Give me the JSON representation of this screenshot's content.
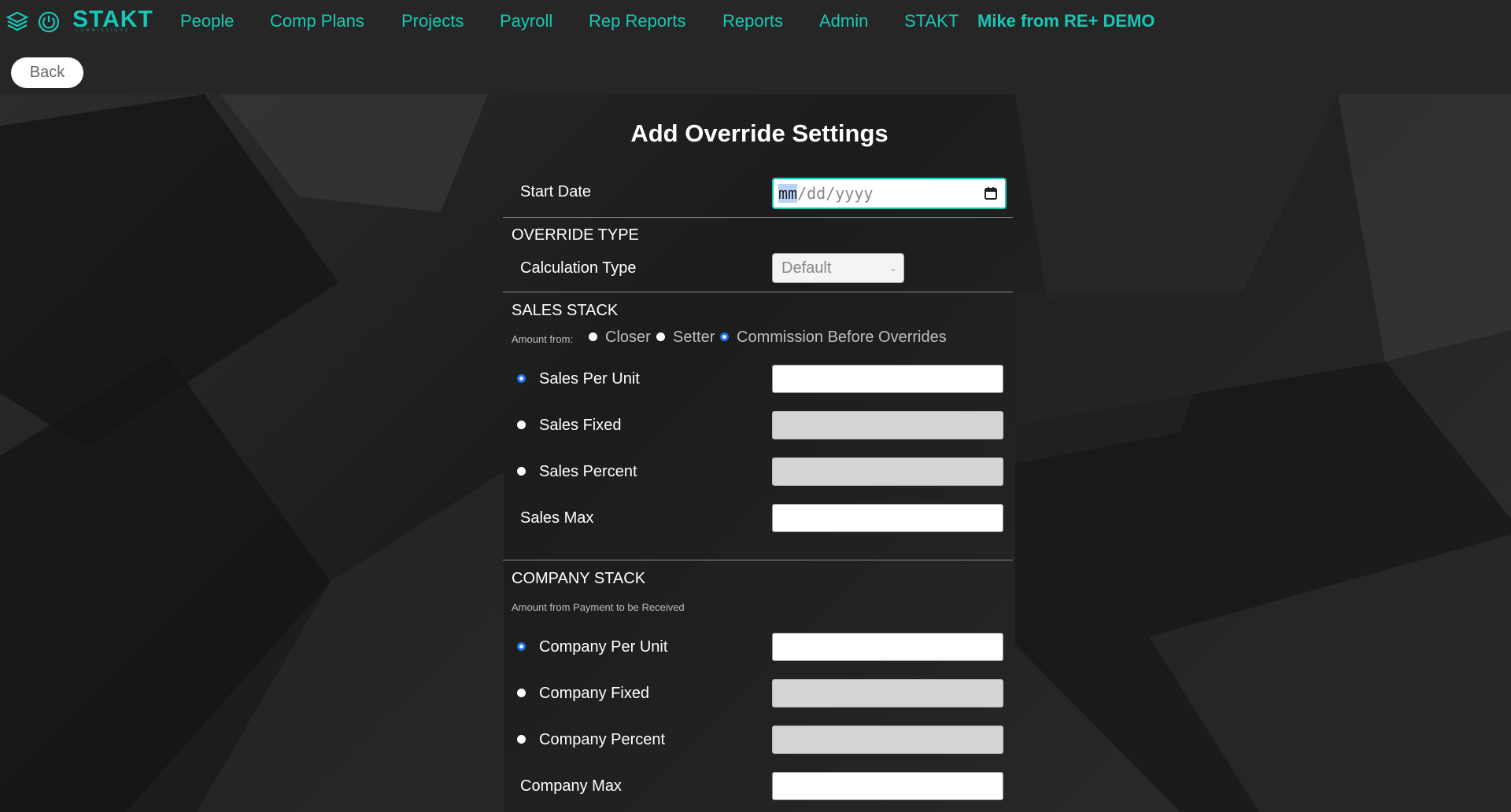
{
  "nav": {
    "logo_text": "STAKT",
    "logo_sub": "COMMISSIONS",
    "links": [
      "People",
      "Comp Plans",
      "Projects",
      "Payroll",
      "Rep Reports",
      "Reports",
      "Admin",
      "STAKT"
    ],
    "user": "Mike from  RE+ DEMO"
  },
  "back_label": "Back",
  "form": {
    "title": "Add Override Settings",
    "start_date_label": "Start Date",
    "start_date_placeholder_mm": "mm",
    "start_date_placeholder_rest": "/dd/yyyy",
    "override_type_title": "OVERRIDE TYPE",
    "calc_type_label": "Calculation Type",
    "calc_type_value": "Default",
    "sales_stack_title": "SALES STACK",
    "amount_from_label": "Amount from:",
    "amount_from_options": [
      "Closer",
      "Setter",
      "Commission Before Overrides"
    ],
    "amount_from_selected": "Commission Before Overrides",
    "sales_per_unit_label": "Sales Per Unit",
    "sales_fixed_label": "Sales Fixed",
    "sales_percent_label": "Sales Percent",
    "sales_max_label": "Sales Max",
    "sales_selected": "Sales Per Unit",
    "company_stack_title": "COMPANY STACK",
    "company_note": "Amount from Payment to be Received",
    "company_per_unit_label": "Company Per Unit",
    "company_fixed_label": "Company Fixed",
    "company_percent_label": "Company Percent",
    "company_max_label": "Company Max",
    "company_selected": "Company Per Unit"
  },
  "colors": {
    "accent": "#19c7b5",
    "radio_selected": "#1a73e8",
    "page_bg": "#1e1e1e",
    "topbar_bg": "#262626"
  }
}
